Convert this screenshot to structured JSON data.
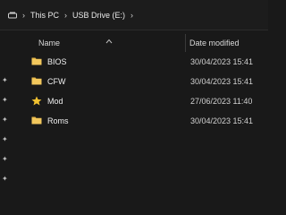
{
  "addressbar": {
    "path": [
      "This PC",
      "USB Drive (E:)"
    ]
  },
  "columns": {
    "name": "Name",
    "date_modified": "Date modified"
  },
  "rows": [
    {
      "name": "BIOS",
      "date": "30/04/2023 15:41",
      "icon": "folder-icon"
    },
    {
      "name": "CFW",
      "date": "30/04/2023 15:41",
      "icon": "folder-icon"
    },
    {
      "name": "Mod",
      "date": "27/06/2023 11:40",
      "icon": "star-folder-icon"
    },
    {
      "name": "Roms",
      "date": "30/04/2023 15:41",
      "icon": "folder-icon"
    }
  ],
  "colors": {
    "folder": "#e8b949",
    "star": "#f2c230",
    "background": "#191919"
  }
}
